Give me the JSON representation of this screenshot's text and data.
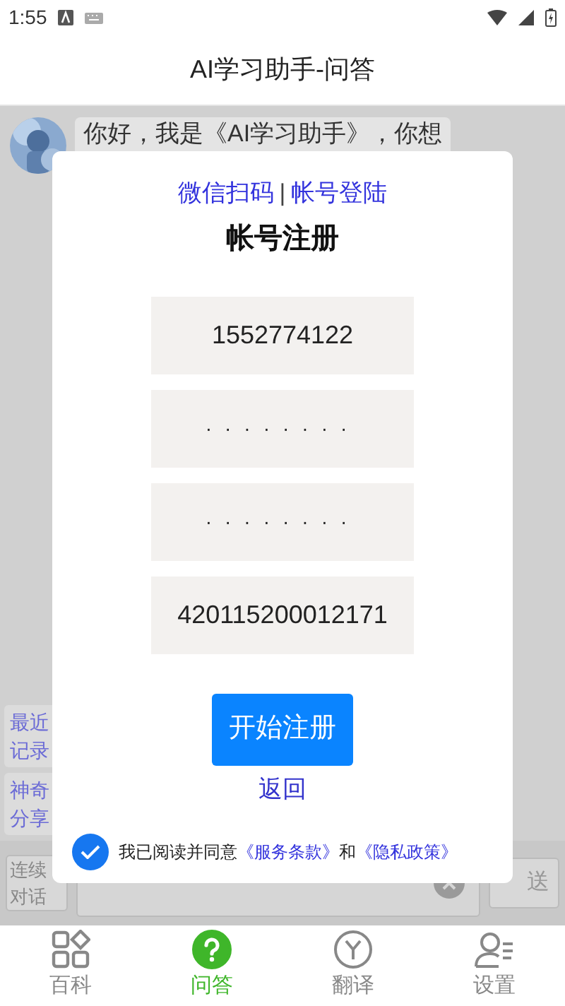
{
  "status_bar": {
    "time": "1:55"
  },
  "header": {
    "title": "AI学习助手-问答"
  },
  "chat": {
    "message": "你好，我是《AI学习助手》，你想"
  },
  "side_buttons": [
    "最近记录",
    "神奇分享"
  ],
  "input_bar": {
    "mode_button": "连续对话",
    "send_button": "送"
  },
  "dialog": {
    "switch_links": [
      "微信扫码",
      "帐号登陆"
    ],
    "separator": "|",
    "title": "帐号注册",
    "fields": [
      {
        "kind": "text",
        "value": "1552774122"
      },
      {
        "kind": "password",
        "value": "········"
      },
      {
        "kind": "password",
        "value": "········"
      },
      {
        "kind": "text",
        "value": "420115200012171"
      }
    ],
    "submit_button": "开始注册",
    "back_link": "返回",
    "agreement": {
      "checked": true,
      "text": "我已阅读并同意",
      "terms": "《服务条款》",
      "and": "和",
      "privacy": "《隐私政策》"
    }
  },
  "nav": [
    {
      "label": "百科",
      "selected": false
    },
    {
      "label": "问答",
      "selected": true
    },
    {
      "label": "翻译",
      "selected": false
    },
    {
      "label": "设置",
      "selected": false
    }
  ]
}
